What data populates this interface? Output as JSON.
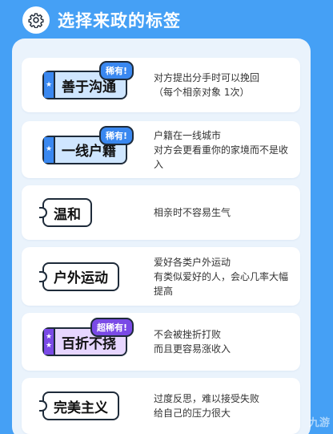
{
  "header": {
    "title": "选择来政的标签",
    "icon": "gear-icon"
  },
  "colors": {
    "background": "#45a0f5",
    "panel": "#eaf3fc",
    "blue_tag": "#cfe6ff",
    "blue_accent": "#3a88f0",
    "purple_tag": "#e7d6ff",
    "purple_accent": "#7a4ae6"
  },
  "tags": [
    {
      "label": "善于沟通",
      "badge": "稀有!",
      "desc1": "对方提出分手时可以挽回",
      "desc2": "（每个相亲对象 1次）",
      "desc3": ""
    },
    {
      "label": "一线户籍",
      "badge": "稀有!",
      "desc1": "户籍在一线城市",
      "desc2": "对方会更看重你的家境而不是收",
      "desc3": "入"
    },
    {
      "label": "温和",
      "badge": "",
      "desc1": "相亲时不容易生气",
      "desc2": "",
      "desc3": ""
    },
    {
      "label": "户外运动",
      "badge": "",
      "desc1": "爱好各类户外运动",
      "desc2": "有类似爱好的人，会心几率大幅",
      "desc3": "提高"
    },
    {
      "label": "百折不挠",
      "badge": "超稀有!",
      "desc1": "不会被挫折打败",
      "desc2": "而且更容易涨收入",
      "desc3": ""
    },
    {
      "label": "完美主义",
      "badge": "",
      "desc1": "过度反思，难以接受失败",
      "desc2": "给自己的压力很大",
      "desc3": ""
    }
  ],
  "watermark": "九游"
}
